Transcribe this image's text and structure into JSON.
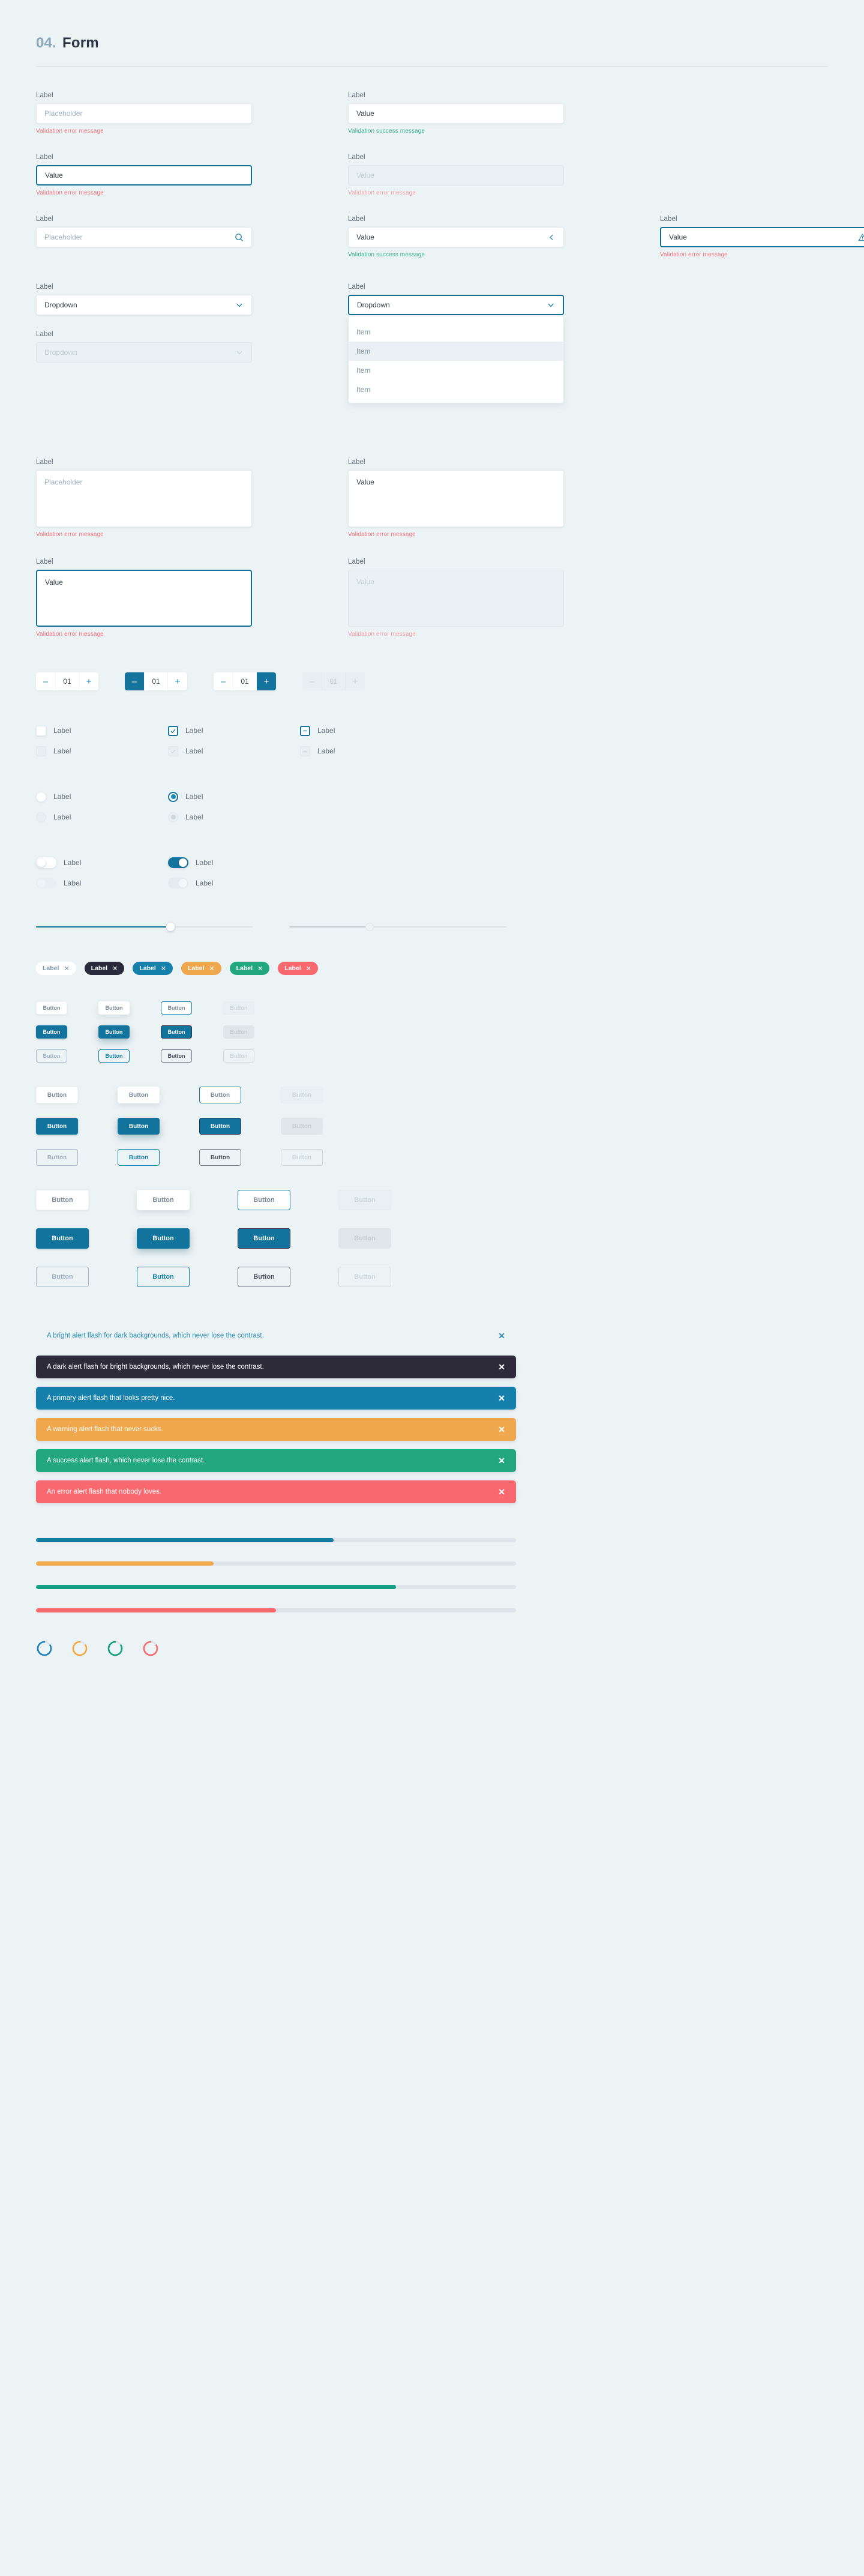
{
  "header": {
    "number": "04.",
    "title": "Form"
  },
  "common": {
    "label": "Label",
    "placeholder": "Placeholder",
    "value": "Value",
    "dropdown": "Dropdown",
    "item": "Item",
    "button": "Button",
    "tag_label": "Label",
    "close_x": "✕",
    "stepper_value": "01",
    "minus": "–",
    "plus": "+",
    "error_message": "Validation error message",
    "success_message": "Validation success message"
  },
  "inputs": {
    "row1": [
      {
        "state": "placeholder",
        "text": "Placeholder",
        "message": "Validation error message",
        "message_type": "error"
      },
      {
        "state": "value",
        "text": "Value",
        "message": "Validation success message",
        "message_type": "success"
      }
    ],
    "row2": [
      {
        "state": "focus",
        "text": "Value",
        "message": "Validation error message",
        "message_type": "error"
      },
      {
        "state": "disabled",
        "text": "Value",
        "message": "Validation error message",
        "message_type": "error-dim"
      }
    ],
    "row3": [
      {
        "state": "placeholder",
        "text": "Placeholder",
        "icon": "search-icon",
        "message": "",
        "message_type": "none"
      },
      {
        "state": "value",
        "text": "Value",
        "icon": "chevron-left-icon",
        "message": "Validation success message",
        "message_type": "success"
      },
      {
        "state": "focus",
        "text": "Value",
        "icon": "warning-triangle-icon",
        "message": "Validation error message",
        "message_type": "error"
      }
    ]
  },
  "dropdowns": {
    "closed": {
      "label": "Label",
      "value": "Dropdown"
    },
    "disabled": {
      "label": "Label",
      "value": "Dropdown"
    },
    "open": {
      "label": "Label",
      "value": "Dropdown",
      "items": [
        "Item",
        "Item",
        "Item",
        "Item"
      ],
      "highlighted_index": 1
    }
  },
  "textareas": [
    {
      "state": "placeholder",
      "text": "Placeholder",
      "message": "Validation error message",
      "message_type": "error"
    },
    {
      "state": "value",
      "text": "Value",
      "message": "Validation error message",
      "message_type": "error"
    },
    {
      "state": "focus",
      "text": "Value",
      "message": "Validation error message",
      "message_type": "error"
    },
    {
      "state": "disabled",
      "text": "Value",
      "message": "Validation error message",
      "message_type": "error-dim"
    }
  ],
  "steppers": [
    {
      "state": "default",
      "value": "01",
      "minus_active": false,
      "plus_active": false
    },
    {
      "state": "minus-active",
      "value": "01",
      "minus_active": true,
      "plus_active": false
    },
    {
      "state": "plus-active",
      "value": "01",
      "minus_active": false,
      "plus_active": true
    },
    {
      "state": "disabled",
      "value": "01",
      "minus_active": false,
      "plus_active": false
    }
  ],
  "checkboxes": [
    {
      "state": "unchecked",
      "label": "Label"
    },
    {
      "state": "checked",
      "label": "Label"
    },
    {
      "state": "indeterminate",
      "label": "Label"
    },
    {
      "state": "unchecked-disabled",
      "label": "Label"
    },
    {
      "state": "checked-disabled",
      "label": "Label"
    },
    {
      "state": "indeterminate-disabled",
      "label": "Label"
    }
  ],
  "radios": [
    {
      "state": "unselected",
      "label": "Label"
    },
    {
      "state": "selected",
      "label": "Label"
    },
    {
      "state": "unselected-disabled",
      "label": "Label"
    },
    {
      "state": "selected-disabled",
      "label": "Label"
    }
  ],
  "toggles": [
    {
      "state": "off",
      "label": "Label"
    },
    {
      "state": "on",
      "label": "Label"
    },
    {
      "state": "off-disabled",
      "label": "Label"
    },
    {
      "state": "on-disabled",
      "label": "Label"
    }
  ],
  "sliders": [
    {
      "state": "active",
      "percent": 62
    },
    {
      "state": "disabled",
      "percent": 37
    }
  ],
  "tags": [
    {
      "label": "Label",
      "bg": "#ffffff",
      "fg": "#7b98b4",
      "close": "✕"
    },
    {
      "label": "Label",
      "bg": "#2a2a3a",
      "fg": "#ffffff",
      "close": "✕"
    },
    {
      "label": "Label",
      "bg": "#1580ab",
      "fg": "#ffffff",
      "close": "✕"
    },
    {
      "label": "Label",
      "bg": "#f0a84f",
      "fg": "#ffffff",
      "close": "✕"
    },
    {
      "label": "Label",
      "bg": "#22a77f",
      "fg": "#ffffff",
      "close": "✕"
    },
    {
      "label": "Label",
      "bg": "#f9686f",
      "fg": "#ffffff",
      "close": "✕"
    }
  ],
  "buttons": {
    "sizes": [
      "small",
      "medium",
      "large"
    ],
    "variants": [
      "secondary",
      "primary",
      "outline"
    ],
    "states": [
      "default",
      "hover",
      "focus",
      "disabled"
    ],
    "label": "Button"
  },
  "alerts": [
    {
      "variant": "bright",
      "text": "A bright alert flash for dark backgrounds, which never lose the contrast.",
      "bg": "#ecf3f5",
      "fg": "#2f8fba",
      "close": "✕"
    },
    {
      "variant": "dark",
      "text": "A dark alert flash for bright backgrounds, which never lose the contrast.",
      "bg": "#2d2b3a",
      "fg": "#ffffff",
      "close": "✕"
    },
    {
      "variant": "primary",
      "text": "A primary alert flash that looks pretty nice.",
      "bg": "#1580ab",
      "fg": "#ffffff",
      "close": "✕"
    },
    {
      "variant": "warning",
      "text": "A warning alert flash that never sucks.",
      "bg": "#f0a84f",
      "fg": "#ffffff",
      "close": "✕"
    },
    {
      "variant": "success",
      "text": "A success alert flash, which never lose the contrast.",
      "bg": "#22a77f",
      "fg": "#ffffff",
      "close": "✕"
    },
    {
      "variant": "error",
      "text": "An error alert flash that nobody loves.",
      "bg": "#f9686f",
      "fg": "#ffffff",
      "close": "✕"
    }
  ],
  "progress_bars": [
    {
      "variant": "primary",
      "percent": 62,
      "color": "#12799f",
      "track": "#dee4e9"
    },
    {
      "variant": "warning",
      "percent": 37,
      "color": "#f0a84f",
      "track": "#dee4e9"
    },
    {
      "variant": "success",
      "percent": 75,
      "color": "#12a183",
      "track": "#dee4e9"
    },
    {
      "variant": "error",
      "percent": 50,
      "color": "#f9686f",
      "track": "#dee4e9"
    }
  ],
  "spinners": [
    {
      "variant": "primary",
      "color": "#1a7fbd"
    },
    {
      "variant": "warning",
      "color": "#f3a83c"
    },
    {
      "variant": "success",
      "color": "#0f9f7b"
    },
    {
      "variant": "error",
      "color": "#f9686f"
    }
  ]
}
